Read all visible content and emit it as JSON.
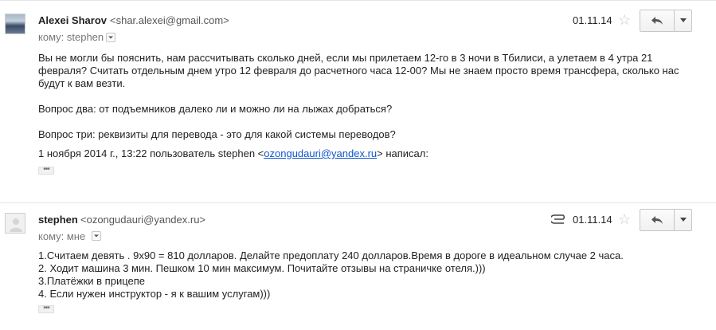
{
  "messages": [
    {
      "sender": "Alexei Sharov",
      "email": "<shar.alexei@gmail.com>",
      "to_label": "кому: stephen",
      "date": "01.11.14",
      "body": [
        "Вы не могли бы пояснить, нам рассчитывать сколько дней, если мы прилетаем 12-го в 3 ночи в Тбилиси, а улетаем в 4 утра 21",
        "февраля? Считать отдельным днем утро 12 февраля до расчетного часа 12-00? Мы не знаем просто время трансфера, сколько нас",
        "будут к вам везти.",
        "Вопрос два: от подъемников далеко ли и можно ли на лыжах добраться?",
        "Вопрос три: реквизиты для перевода - это для какой системы переводов?"
      ],
      "quote_prefix": "1 ноября 2014 г., 13:22 пользователь stephen <",
      "quote_link": "ozongudauri@yandex.ru",
      "quote_suffix": "> написал:",
      "dots": "•••"
    },
    {
      "sender": "stephen",
      "email": "<ozongudauri@yandex.ru>",
      "to_label": "кому: мне",
      "date": "01.11.14",
      "body": [
        "1.Считаем девять . 9х90 = 810 долларов. Делайте предоплату 240 долларов.Время в дороге в идеальном случае 2 часа.",
        "2. Ходит машина 3 мин. Пешком 10 мин максимум. Почитайте отзывы на страничке отеля.)))",
        "3.Платёжки в прицепе",
        "4. Если нужен инструктор - я к вашим услугам)))"
      ],
      "dots": "•••"
    }
  ],
  "icons": {
    "star": "star-icon",
    "reply": "reply-arrow-icon",
    "more": "dropdown-arrow-icon",
    "attachment": "paperclip-icon"
  },
  "colors": {
    "link": "#1155cc",
    "muted": "#777777",
    "star": "#c8c8c8"
  }
}
